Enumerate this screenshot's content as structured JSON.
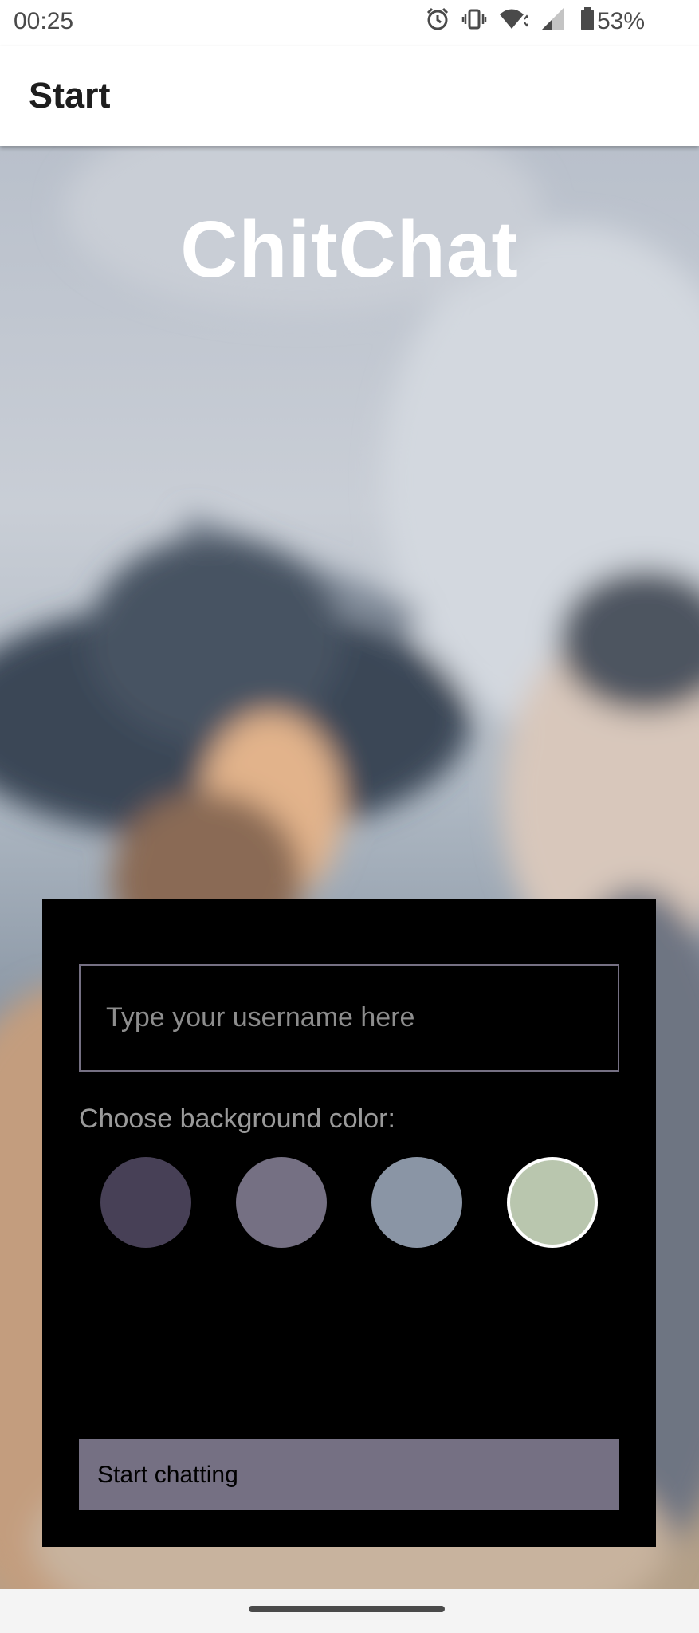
{
  "status_bar": {
    "time": "00:25",
    "battery": "53%",
    "icons": [
      "alarm-icon",
      "vibrate-icon",
      "wifi-icon",
      "signal-icon",
      "battery-icon"
    ]
  },
  "app_bar": {
    "title": "Start"
  },
  "hero": {
    "app_name": "ChitChat"
  },
  "form": {
    "username_placeholder": "Type your username here",
    "color_label": "Choose background color:",
    "colors": [
      "#474056",
      "#757083",
      "#8A95A5",
      "#B9C6AE"
    ],
    "selected_color_index": 3,
    "start_button_label": "Start chatting"
  }
}
